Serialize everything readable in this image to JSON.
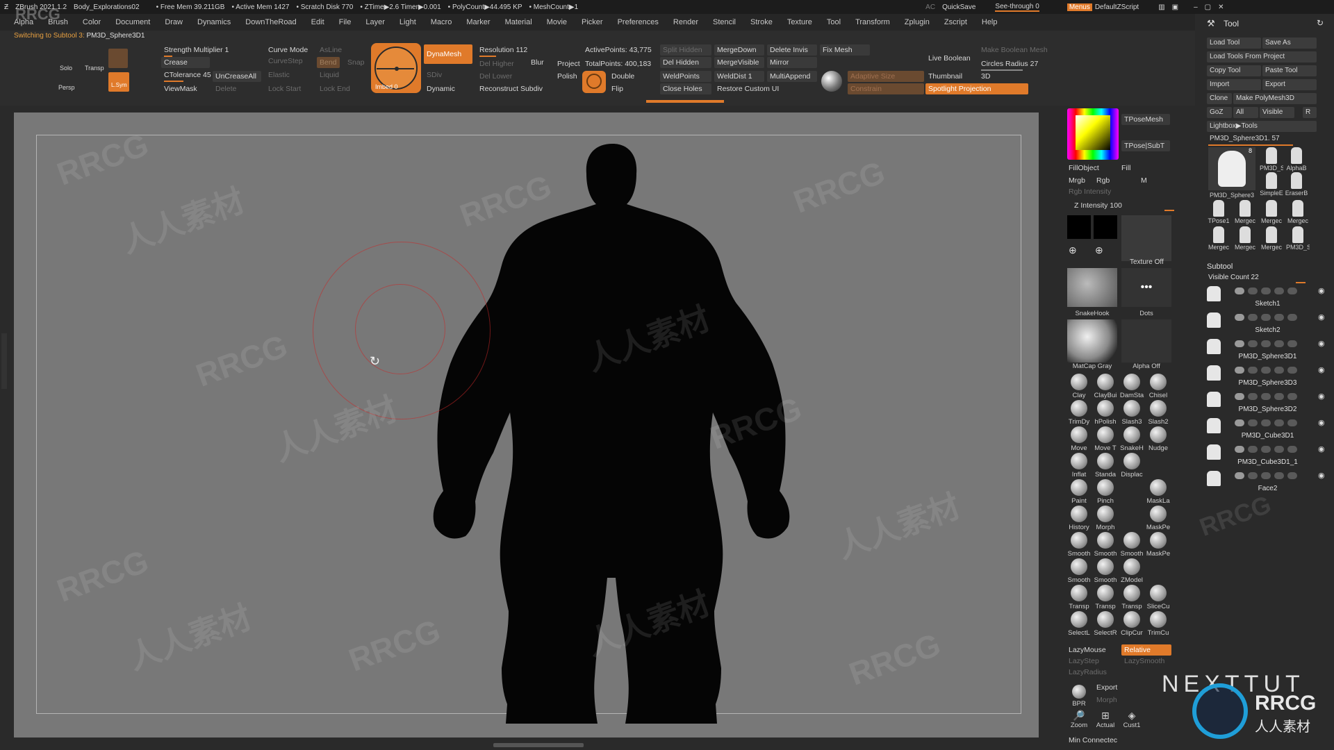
{
  "titlebar": {
    "app": "ZBrush 2021.1.2",
    "doc": "Body_Explorations02",
    "free_mem": "• Free Mem 39.211GB",
    "active_mem": "• Active Mem 1427",
    "scratch": "• Scratch Disk 770",
    "ztime": "• ZTime▶2.6 Timer▶0.001",
    "polycount": "• PolyCount▶44.495 KP",
    "meshcount": "• MeshCount▶1",
    "ac": "AC",
    "quicksave": "QuickSave",
    "seethrough": "See-through  0",
    "menus": "Menus",
    "script": "DefaultZScript"
  },
  "menu": [
    "Alpha",
    "Brush",
    "Color",
    "Document",
    "Draw",
    "Dynamics",
    "DownTheRoad",
    "Edit",
    "File",
    "Layer",
    "Light",
    "Macro",
    "Marker",
    "Material",
    "Movie",
    "Picker",
    "Preferences",
    "Render",
    "Stencil",
    "Stroke",
    "Texture",
    "Tool",
    "Transform",
    "Zplugin",
    "Zscript",
    "Help"
  ],
  "status": {
    "prefix": "Switching to Subtool 3:",
    "name": "PM3D_Sphere3D1"
  },
  "palette": {
    "solo": "Solo",
    "transp": "Transp",
    "persp": "Persp",
    "lsym": "L.Sym",
    "strength": "Strength Multiplier 1",
    "crease": "Crease",
    "ctolerance": "CTolerance 45",
    "uncrease": "UnCreaseAll",
    "viewmask": "ViewMask",
    "delete": "Delete",
    "curvemode": "Curve Mode",
    "curvestep": "CurveStep",
    "asline": "AsLine",
    "bend": "Bend",
    "snap": "Snap",
    "elastic": "Elastic",
    "liquid": "Liquid",
    "lockstart": "Lock Start",
    "lockend": "Lock End",
    "dynamesh": "DynaMesh",
    "dynamic": "Dynamic",
    "resolution": "Resolution 112",
    "delhigher": "Del Higher",
    "dellower": "Del Lower",
    "blur": "Blur",
    "project": "Project",
    "polish": "Polish",
    "reconstruct": "Reconstruct Subdiv",
    "sdiv": "SDiv",
    "imbed": "Imbed 0",
    "activepoints": "ActivePoints: 43,775",
    "totalpoints": "TotalPoints: 400,183",
    "double": "Double",
    "flip": "Flip",
    "splithidden": "Split Hidden",
    "delhidden": "Del Hidden",
    "weldpoints": "WeldPoints",
    "closeholes": "Close Holes",
    "mergedown": "MergeDown",
    "mergevisible": "MergeVisible",
    "welddist": "WeldDist 1",
    "restore": "Restore Custom UI",
    "deleteinvis": "Delete Invis",
    "mirror": "Mirror",
    "multiappend": "MultiAppend",
    "fixmesh": "Fix Mesh",
    "adaptive": "Adaptive Size",
    "constrain": "Constrain",
    "liveboolean": "Live Boolean",
    "thumbnail": "Thumbnail",
    "3d": "3D",
    "spotlight": "Spotlight Projection",
    "makeboolean": "Make Boolean Mesh",
    "circlesradius": "Circles Radius 27"
  },
  "shelf": {
    "tpose": "TPoseMesh",
    "tposesub": "TPose|SubT",
    "fillobject": "FillObject",
    "fill": "Fill",
    "mrgb": "Mrgb",
    "rgb": "Rgb",
    "m": "M",
    "rgbint": "Rgb Intensity",
    "zint": "Z Intensity 100",
    "textureoff": "Texture Off",
    "snakehook": "SnakeHook",
    "dots": "Dots",
    "matcap": "MatCap Gray",
    "alphaoff": "Alpha Off",
    "brushes": [
      [
        "Clay",
        "ClayBui",
        "DamSta",
        "Chisel"
      ],
      [
        "TrimDy",
        "hPolish",
        "Slash3",
        "Slash2"
      ],
      [
        "Move",
        "Move T",
        "SnakeH",
        "Nudge"
      ],
      [
        "Inflat",
        "Standa",
        "Displac",
        ""
      ],
      [
        "Paint",
        "Pinch",
        "",
        "MaskLa"
      ],
      [
        "History",
        "Morph",
        "",
        "MaskPe"
      ],
      [
        "Smooth",
        "Smooth",
        "Smooth",
        "MaskPe"
      ],
      [
        "Smooth",
        "Smooth",
        "ZModel",
        ""
      ],
      [
        "Transp",
        "Transp",
        "Transp",
        "SliceCu"
      ],
      [
        "SelectL",
        "SelectR",
        "ClipCur",
        "TrimCu"
      ]
    ],
    "lazymouse": "LazyMouse",
    "relative": "Relative",
    "lazystep": "LazyStep",
    "lazysmooth": "LazySmooth",
    "lazyradius": "LazyRadius",
    "bpr": "BPR",
    "export": "Export",
    "morph": "Morph",
    "zoom": "Zoom",
    "actual": "Actual",
    "cust1": "Cust1",
    "minconnect": "Min Connectec"
  },
  "tool": {
    "title": "Tool",
    "load": "Load Tool",
    "saveas": "Save As",
    "loadproject": "Load Tools From Project",
    "copy": "Copy Tool",
    "paste": "Paste Tool",
    "import": "Import",
    "export": "Export",
    "clone": "Clone",
    "makepoly": "Make PolyMesh3D",
    "goz": "GoZ",
    "all": "All",
    "visible": "Visible",
    "r": "R",
    "lightbox": "Lightbox▶Tools",
    "current": "PM3D_Sphere3D1. 57",
    "thumbs1": [
      "PM3D_Sphere3",
      "PM3D_S",
      "AlphaB"
    ],
    "thumbs1b": [
      "SimpleE",
      "EraserB"
    ],
    "thumbs2": [
      "TPose1",
      "Mergec",
      "Mergec",
      "Mergec"
    ],
    "thumbs3": [
      "Mergec",
      "Mergec",
      "Mergec",
      "PM3D_S"
    ],
    "count8": "8",
    "subtool": "Subtool",
    "visiblecount": "Visible Count 22",
    "subtools": [
      "Sketch1",
      "Sketch2",
      "PM3D_Sphere3D1",
      "PM3D_Sphere3D3",
      "PM3D_Sphere3D2",
      "PM3D_Cube3D1",
      "PM3D_Cube3D1_1",
      "Face2"
    ]
  },
  "watermark": {
    "rrcg": "RRCG",
    "cn": "人人素材",
    "nexttut": "NEXTTUT",
    "logo_text": "RRCG",
    "logo_cn": "人人素材"
  },
  "colors": {
    "accent": "#e07a2a",
    "viewport": "#787878",
    "silhouette": "#050505"
  }
}
